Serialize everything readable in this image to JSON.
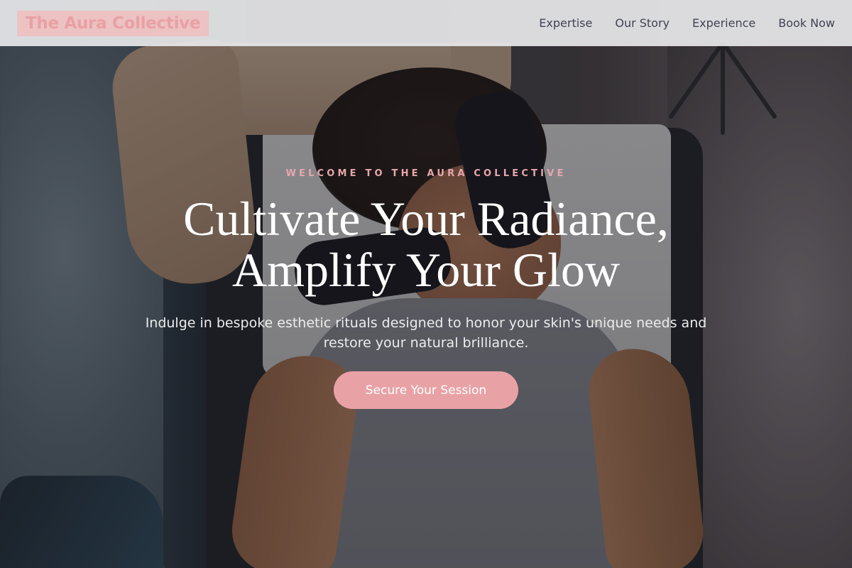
{
  "header": {
    "logo": "The Aura Collective",
    "nav": [
      "Expertise",
      "Our Story",
      "Experience",
      "Book Now"
    ]
  },
  "hero": {
    "eyebrow": "WELCOME TO THE AURA COLLECTIVE",
    "headline_line1": "Cultivate Your Radiance,",
    "headline_line2": "Amplify Your Glow",
    "subtext": "Indulge in bespoke esthetic rituals designed to honor your skin's unique needs and restore your natural brilliance.",
    "cta_label": "Secure Your Session",
    "image_description_icon": "facial-treatment-photo"
  },
  "colors": {
    "accent_pink": "#e8a2a6",
    "logo_text": "#e9a0a5",
    "nav_text": "#3e4452"
  }
}
